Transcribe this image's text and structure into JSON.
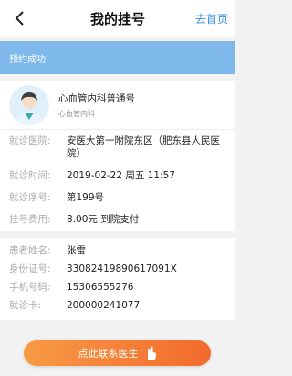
{
  "header": {
    "title": "我的挂号",
    "home_label": "去首页"
  },
  "banner": {
    "text": "预约成功"
  },
  "doctor": {
    "name": "心血管内科普通号",
    "dept": "心血管内科"
  },
  "appointment": {
    "hospital_label": "就诊医院:",
    "hospital_value": "安医大第一附院东区（肥东县人民医院）",
    "time_label": "就诊时间:",
    "time_value": "2019-02-22 周五 11:57",
    "seq_label": "就诊序号:",
    "seq_value": "第199号",
    "fee_label": "挂号费用:",
    "fee_value": "8.00元 到院支付"
  },
  "patient": {
    "name_label": "患者姓名:",
    "name_value": "张雷",
    "id_label": "身份证号:",
    "id_value": "33082419890617091X",
    "phone_label": "手机号码:",
    "phone_value": "15306555276",
    "card_label": "就诊卡:",
    "card_value": "200000241077"
  },
  "cta": {
    "label": "点此联系医生"
  },
  "colors": {
    "accent": "#3a8ee6",
    "banner": "#7fb9ec",
    "cta_start": "#f89a45",
    "cta_end": "#f26a2c"
  },
  "icons": {
    "back": "chevron-left-icon",
    "avatar": "doctor-avatar-icon",
    "hand": "hand-pointer-icon"
  }
}
